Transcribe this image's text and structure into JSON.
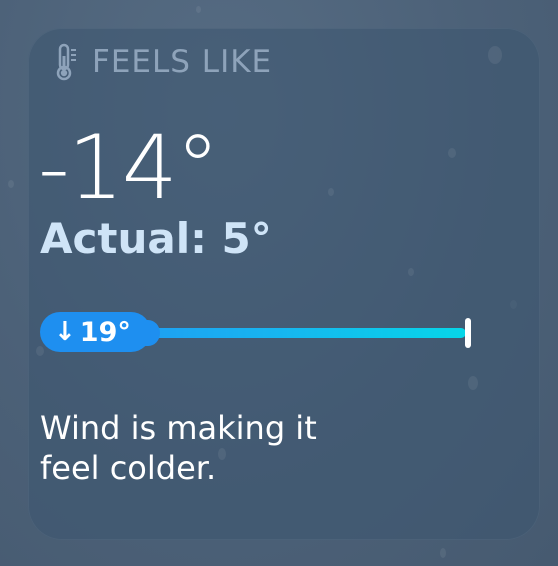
{
  "widget": {
    "header_label": "FEELS LIKE",
    "icon": "thermometer-icon",
    "feels_like_temp": "-14°",
    "actual_temp": "Actual: 5°",
    "bar": {
      "marker_label": "19°",
      "arrow_icon": "↓",
      "start_color": "#2196f3",
      "end_color": "#06d6e8"
    },
    "description_line1": "Wind is making it",
    "description_line2": "feel colder."
  }
}
